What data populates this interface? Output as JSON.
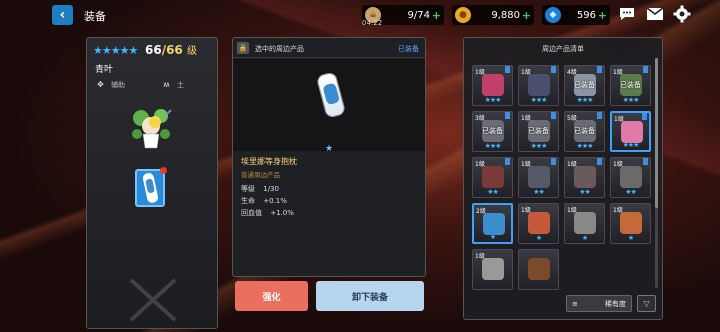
{
  "header": {
    "back_icon": "chevron-left-icon",
    "title": "装备",
    "stamina": "9/74",
    "timer": "04:22",
    "gold": "9,880",
    "gems": "596",
    "plus": "+"
  },
  "character": {
    "stars": "★★★★★",
    "level_current": "66",
    "level_max": "/66",
    "level_unit": "级",
    "name": "青叶",
    "role": "辅助",
    "element": "土"
  },
  "selected_item": {
    "header": "选中的周边产品",
    "status": "已装备",
    "star": "★",
    "name": "埃里娜等身抱枕",
    "category": "普通周边产品",
    "stats": [
      {
        "label": "等级",
        "value": "1/30"
      },
      {
        "label": "生命",
        "value": "+0.1%"
      },
      {
        "label": "回血值",
        "value": "+1.0%"
      }
    ],
    "strengthen_label": "强化",
    "unequip_label": "卸下装备"
  },
  "inventory": {
    "title": "周边产品清单",
    "sort_label": "稀有度",
    "items": [
      {
        "level": "1级",
        "stars": "★★★",
        "equipped": "",
        "art": "#c0406a"
      },
      {
        "level": "1级",
        "stars": "★★★",
        "equipped": "",
        "art": "#4a4f6e"
      },
      {
        "level": "4级",
        "stars": "★★★",
        "equipped": "已装备",
        "art": "#8d95a3"
      },
      {
        "level": "1级",
        "stars": "★★★",
        "equipped": "已装备",
        "art": "#5b7c4e"
      },
      {
        "level": "3级",
        "stars": "★★★",
        "equipped": "已装备",
        "art": "#6b6b75"
      },
      {
        "level": "1级",
        "stars": "★★★",
        "equipped": "已装备",
        "art": "#6b6b75"
      },
      {
        "level": "5级",
        "stars": "★★★",
        "equipped": "已装备",
        "art": "#6b6b75"
      },
      {
        "level": "1级",
        "stars": "★★★",
        "equipped": "",
        "art": "#e07aa8"
      },
      {
        "level": "1级",
        "stars": "★★",
        "equipped": "",
        "art": "#7a3a3a"
      },
      {
        "level": "1级",
        "stars": "★★",
        "equipped": "",
        "art": "#555a66"
      },
      {
        "level": "1级",
        "stars": "★★",
        "equipped": "",
        "art": "#6b5a5a"
      },
      {
        "level": "1级",
        "stars": "★★",
        "equipped": "",
        "art": "#6a6a6a"
      },
      {
        "level": "2级",
        "stars": "★",
        "equipped": "",
        "art": "#3a8dcf"
      },
      {
        "level": "1级",
        "stars": "★",
        "equipped": "",
        "art": "#c45a3a"
      },
      {
        "level": "1级",
        "stars": "★",
        "equipped": "",
        "art": "#888"
      },
      {
        "level": "1级",
        "stars": "★",
        "equipped": "",
        "art": "#c46a3a"
      },
      {
        "level": "1级",
        "stars": "",
        "equipped": "",
        "art": "#999"
      },
      {
        "level": "",
        "stars": "",
        "equipped": "",
        "art": "#7a4a2a"
      }
    ]
  }
}
